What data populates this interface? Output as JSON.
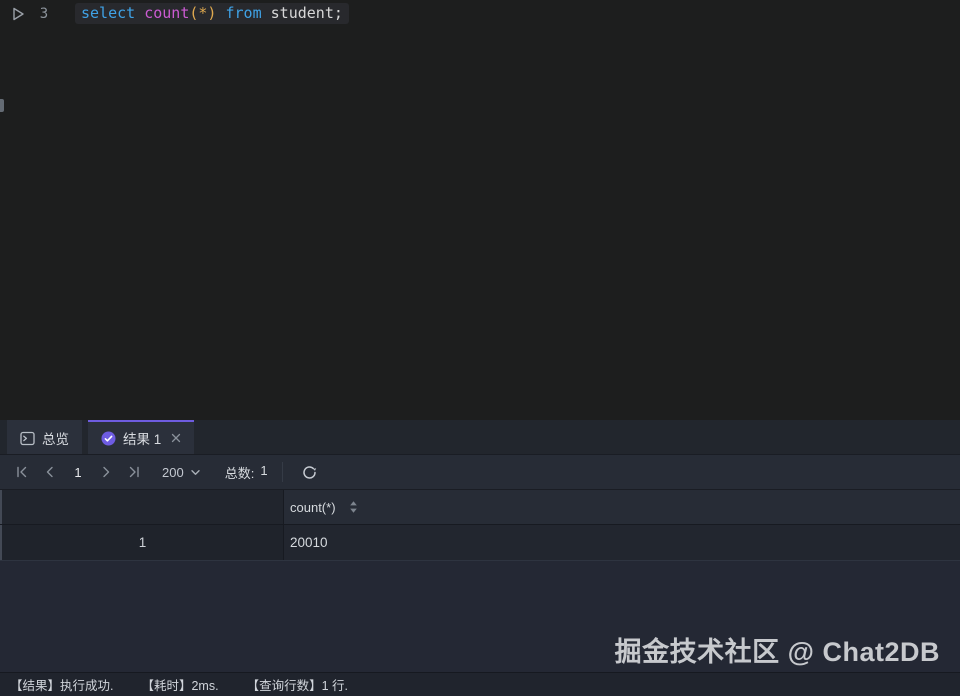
{
  "colors": {
    "keyword": "#3FA2E6",
    "function": "#CB5BD2",
    "bracket": "#DFA94F",
    "plain": "#D8D8D8",
    "accent": "#6E5CE0"
  },
  "editor": {
    "line_number": "3",
    "sql_text": "select count(*) from student;",
    "sql_tokens": [
      {
        "text": "select",
        "color": "keyword"
      },
      {
        "text": " ",
        "color": "plain"
      },
      {
        "text": "count",
        "color": "function"
      },
      {
        "text": "(*)",
        "color": "bracket"
      },
      {
        "text": " ",
        "color": "plain"
      },
      {
        "text": "from",
        "color": "keyword"
      },
      {
        "text": " ",
        "color": "plain"
      },
      {
        "text": "student;",
        "color": "plain"
      }
    ]
  },
  "tabs": {
    "overview_label": "总览",
    "result_label": "结果 1"
  },
  "toolbar": {
    "page": "1",
    "page_size": "200",
    "total_label": "总数:",
    "total_value": "1"
  },
  "table": {
    "header": {
      "column": "count(*)"
    },
    "rows": [
      {
        "index": "1",
        "value": "20010"
      }
    ]
  },
  "status": {
    "segments": [
      "【结果】执行成功.",
      "【耗时】2ms.",
      "【查询行数】1 行."
    ]
  },
  "watermark": "掘金技术社区 @ Chat2DB"
}
